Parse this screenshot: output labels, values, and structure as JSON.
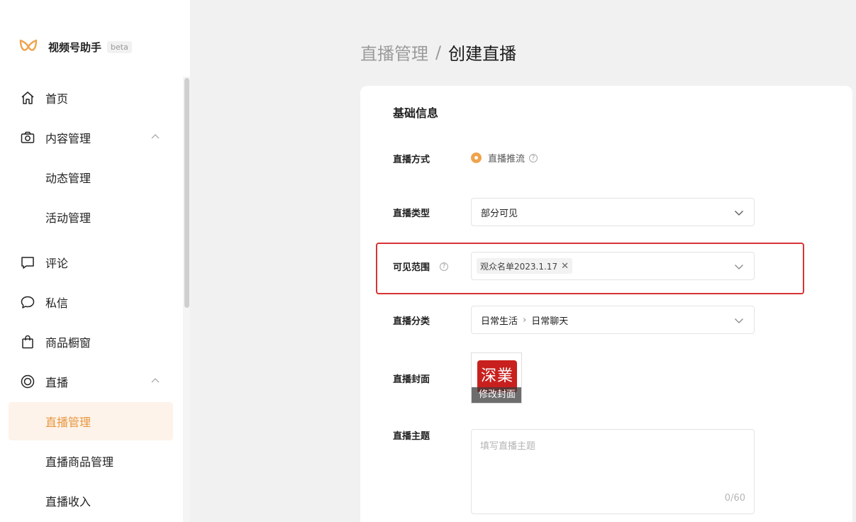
{
  "brand": {
    "name": "视频号助手",
    "tag": "beta",
    "logo_color": "#f0a34c"
  },
  "sidebar": {
    "items": [
      {
        "label": "首页",
        "icon": "home-icon"
      },
      {
        "label": "内容管理",
        "icon": "camera-icon"
      },
      {
        "label": "动态管理"
      },
      {
        "label": "活动管理"
      },
      {
        "label": "评论",
        "icon": "comment-icon"
      },
      {
        "label": "私信",
        "icon": "message-icon"
      },
      {
        "label": "商品橱窗",
        "icon": "shopping-bag-icon"
      },
      {
        "label": "直播",
        "icon": "live-icon"
      },
      {
        "label": "直播管理"
      },
      {
        "label": "直播商品管理"
      },
      {
        "label": "直播收入"
      }
    ],
    "active_color": "#e8963e"
  },
  "breadcrumb": {
    "parent": "直播管理",
    "separator": "/",
    "current": "创建直播"
  },
  "form": {
    "section_title": "基础信息",
    "live_method": {
      "label": "直播方式",
      "option": "直播推流"
    },
    "live_type": {
      "label": "直播类型",
      "value": "部分可见"
    },
    "visibility": {
      "label": "可见范围",
      "tag": "观众名单2023.1.17",
      "tag_remove": "✕"
    },
    "category": {
      "label": "直播分类",
      "level1": "日常生活",
      "separator": "›",
      "level2": "日常聊天"
    },
    "cover": {
      "label": "直播封面",
      "seal_text": "深業",
      "caption": "修改封面"
    },
    "topic": {
      "label": "直播主题",
      "placeholder": "填写直播主题",
      "counter": "0/60"
    },
    "help_glyph": "?",
    "highlight_color": "#d83434"
  }
}
